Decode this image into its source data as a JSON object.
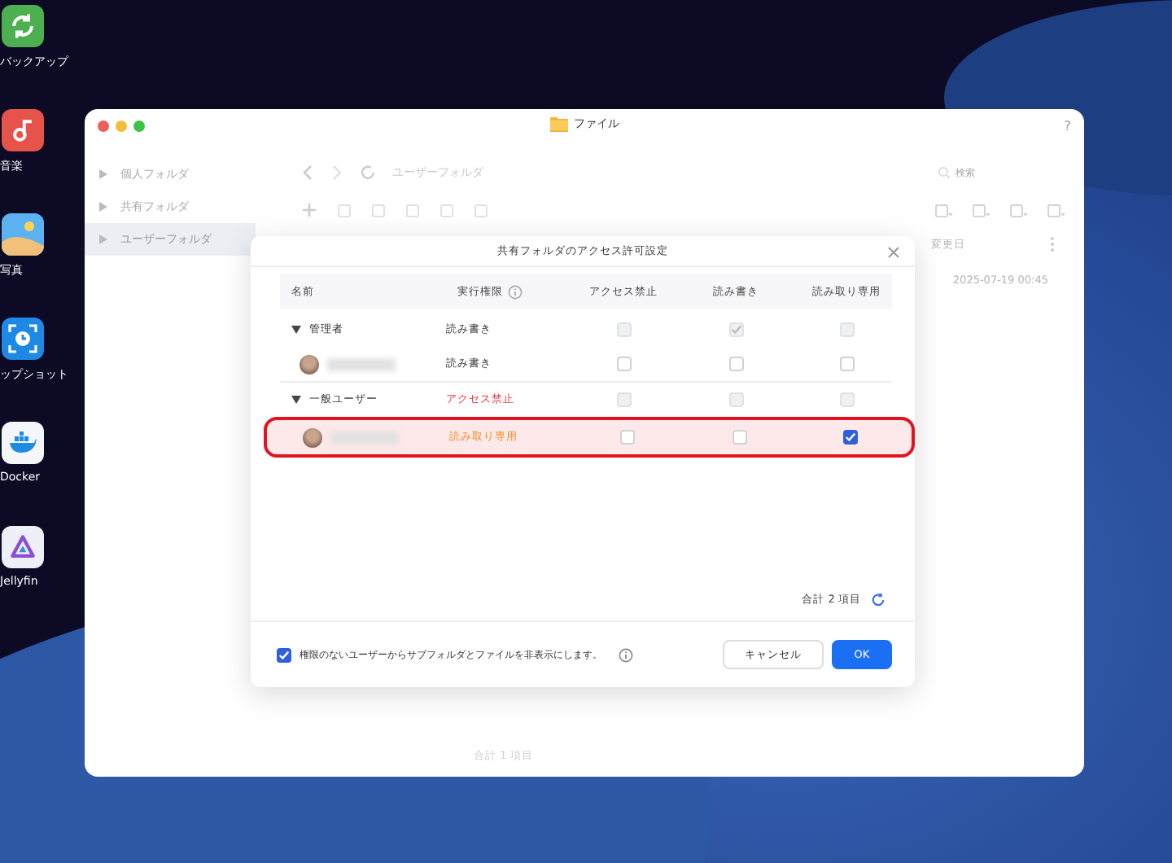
{
  "desktop_icons": [
    {
      "label": "バックアップ",
      "kind": "backup"
    },
    {
      "label": "音楽",
      "kind": "music"
    },
    {
      "label": "写真",
      "kind": "photos"
    },
    {
      "label": "ップショット",
      "kind": "snapshot"
    },
    {
      "label": "Docker",
      "kind": "docker"
    },
    {
      "label": "Jellyfin",
      "kind": "jellyfin"
    }
  ],
  "window": {
    "title": "ファイル",
    "help": "?"
  },
  "sidebar": {
    "items": [
      {
        "label": "個人フォルダ",
        "selected": false
      },
      {
        "label": "共有フォルダ",
        "selected": false
      },
      {
        "label": "ユーザーフォルダ",
        "selected": true
      }
    ]
  },
  "toolbar": {
    "path": "ユーザーフォルダ",
    "search": {
      "placeholder": "検索"
    }
  },
  "file_list": {
    "columns": [
      "変更日"
    ],
    "rows": [
      [
        "2025-07-19 00:45"
      ]
    ],
    "footer": "合計 1 項目"
  },
  "dialog": {
    "title": "共有フォルダのアクセス許可設定",
    "columns": [
      "名前",
      "実行権限",
      "アクセス禁止",
      "読み書き",
      "読み取り専用"
    ],
    "groups": [
      {
        "name": "管理者",
        "expanded": true,
        "permission": "読み書き",
        "kind": "read_write",
        "deny": {
          "checked": false,
          "disabled": true
        },
        "read_write": {
          "checked": true,
          "disabled": true
        },
        "read_only": {
          "checked": false,
          "disabled": true
        },
        "children": [
          {
            "permission": "読み書き",
            "kind": "read_write",
            "highlighted": false,
            "deny": {
              "checked": false,
              "disabled": false
            },
            "read_write": {
              "checked": false,
              "disabled": false
            },
            "read_only": {
              "checked": false,
              "disabled": false
            }
          }
        ]
      },
      {
        "name": "一般ユーザー",
        "expanded": true,
        "permission": "アクセス禁止",
        "kind": "deny",
        "deny": {
          "checked": false,
          "disabled": true
        },
        "read_write": {
          "checked": false,
          "disabled": true
        },
        "read_only": {
          "checked": false,
          "disabled": true
        },
        "children": [
          {
            "permission": "読み取り専用",
            "kind": "read_only",
            "highlighted": true,
            "deny": {
              "checked": false,
              "disabled": false
            },
            "read_write": {
              "checked": false,
              "disabled": false
            },
            "read_only": {
              "checked": true,
              "disabled": false
            }
          }
        ]
      }
    ],
    "total": "合計 2 項目",
    "hide_option": {
      "label": "権限のないユーザーからサブフォルダとファイルを非表示にします。",
      "checked": true
    },
    "buttons": [
      {
        "label": "キャンセル",
        "kind": "secondary"
      },
      {
        "label": "OK",
        "kind": "primary"
      }
    ]
  }
}
